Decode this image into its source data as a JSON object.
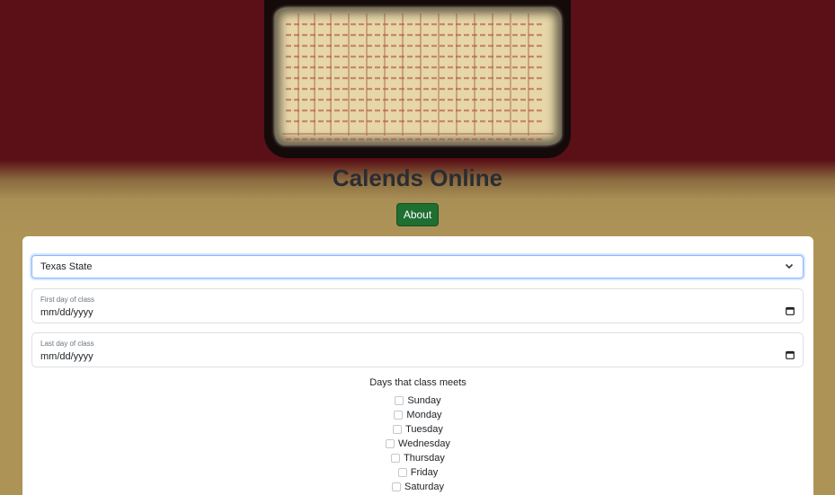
{
  "header": {
    "title": "Calends Online",
    "about_label": "About",
    "colors": {
      "header_bg": "#5a1016",
      "page_bg": "#ad9356",
      "button_bg": "#1f6e32"
    }
  },
  "form": {
    "school_select": {
      "value": "Texas State"
    },
    "first_day": {
      "label": "First day of class",
      "value": "mm/dd/yyyy"
    },
    "last_day": {
      "label": "Last day of class",
      "value": "mm/dd/yyyy"
    },
    "days_title": "Days that class meets",
    "days": [
      {
        "label": "Sunday",
        "checked": false
      },
      {
        "label": "Monday",
        "checked": false
      },
      {
        "label": "Tuesday",
        "checked": false
      },
      {
        "label": "Wednesday",
        "checked": false
      },
      {
        "label": "Thursday",
        "checked": false
      },
      {
        "label": "Friday",
        "checked": false
      },
      {
        "label": "Saturday",
        "checked": false
      }
    ]
  },
  "icons": {
    "select_arrow": "chevron-down-icon",
    "date_picker": "calendar-icon",
    "hero": "ancient-calendar-image"
  }
}
